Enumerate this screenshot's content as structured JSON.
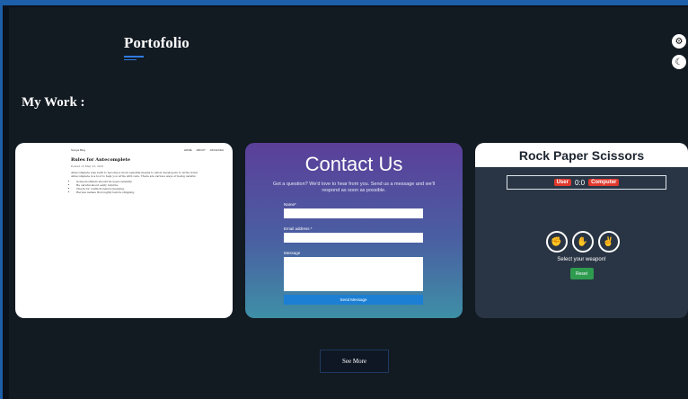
{
  "header": {
    "brand": "Portofolio"
  },
  "controls": {
    "settings_icon": "gear-icon",
    "theme_icon": "moon-icon"
  },
  "work": {
    "title": "My Work :"
  },
  "projects": {
    "doc": {
      "site": "Soniya Blog",
      "nav": [
        "HOME",
        "ABOUT",
        "ARCHIVES"
      ],
      "title": "Rules for Antecomplete",
      "meta": "Posted on May 23, 2021",
      "paragraphs": [
        "Antecomplete was built to become a more sensible means to allow developers to write down",
        "Antecomplete is a tool to help you write with care. There are various ways of being careful."
      ],
      "bullets": [
        "Some modifiers should be used carefully.",
        "Be careful about early returns.",
        "Check for conflicts before merging.",
        "Review names thoroughly before shipping."
      ]
    },
    "contact": {
      "title": "Contact Us",
      "subtitle": "Got a question? We'd love to hear from you. Send us a message and we'll respond as soon as possible.",
      "name_label": "Name*",
      "email_label": "Email address *",
      "message_label": "Message",
      "send_label": "Send Message"
    },
    "rps": {
      "title": "Rock Paper Scissors",
      "user_label": "User",
      "score": "0:0",
      "computer_label": "Computer",
      "prompt": "Select your weapon!",
      "reset_label": "Reset",
      "choices": [
        "rock-icon",
        "paper-icon",
        "scissors-icon"
      ]
    }
  },
  "see_more_label": "See More",
  "colors": {
    "accent": "#2f7be0",
    "background": "#121a22",
    "send": "#1c7fd4",
    "reset": "#2e9b4f",
    "badge": "#e03a2f"
  }
}
